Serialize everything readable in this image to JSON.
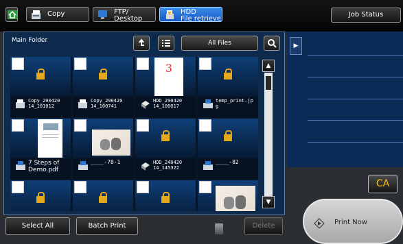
{
  "tabs": [
    {
      "icon": "copy-icon",
      "label": "Copy"
    },
    {
      "icon": "ftp-desktop-icon",
      "line1": "FTP/",
      "line2": "Desktop"
    },
    {
      "icon": "hdd-file-retrieve-icon",
      "line1": "HDD",
      "line2": "File retrieve"
    }
  ],
  "header": {
    "job_status_label": "Job Status"
  },
  "folder": {
    "title": "Main Folder",
    "filter_label": "All Files"
  },
  "files": [
    {
      "name": "",
      "locked": true
    },
    {
      "name": "",
      "locked": true
    },
    {
      "name": "",
      "locked": false,
      "thumb": "3"
    },
    {
      "name": "",
      "locked": true
    },
    {
      "name": "Copy_290420 14_101012",
      "icon": "copy-file-icon"
    },
    {
      "name": "Copy_290420 14_100741",
      "icon": "copy-file-icon"
    },
    {
      "name": "HDD_290420 14_100017",
      "icon": "hdd-file-icon"
    },
    {
      "name": "temp_print.jp g",
      "icon": "print-file-icon"
    },
    {
      "name": "",
      "locked": false,
      "thumb": "document"
    },
    {
      "name": "",
      "locked": false,
      "thumb": "kittens"
    },
    {
      "name": "",
      "locked": true
    },
    {
      "name": "",
      "locked": true
    },
    {
      "name": "7 Steps of Demo.pdf",
      "icon": "print-file-icon"
    },
    {
      "name": "____-78-1",
      "icon": "print-file-icon"
    },
    {
      "name": "HDD_240420 14_145322",
      "icon": "hdd-file-icon"
    },
    {
      "name": "____-82",
      "icon": "print-file-icon"
    },
    {
      "name": "",
      "locked": true
    },
    {
      "name": "",
      "locked": true
    },
    {
      "name": "",
      "locked": true
    },
    {
      "name": "",
      "locked": false,
      "thumb": "kittens"
    }
  ],
  "footer": {
    "select_all": "Select All",
    "batch_print": "Batch Print",
    "delete": "Delete"
  },
  "side": {
    "ca_label": "CA",
    "print_now": "Print Now"
  }
}
